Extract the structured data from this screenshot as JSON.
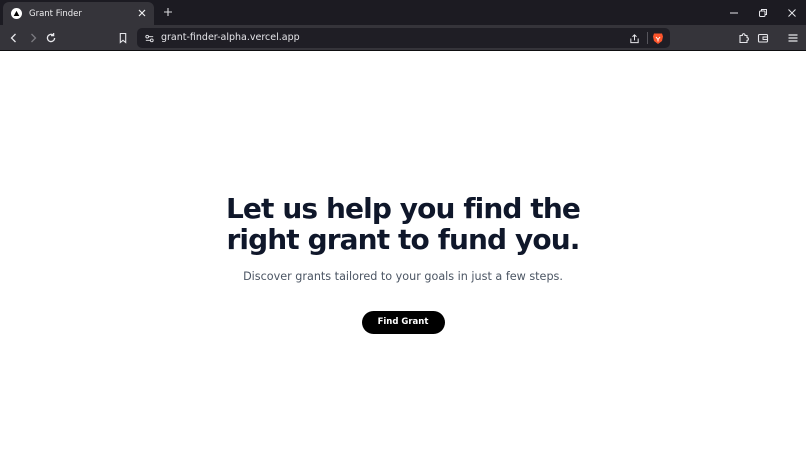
{
  "browser": {
    "tab": {
      "title": "Grant Finder"
    },
    "address_bar": {
      "url": "grant-finder-alpha.vercel.app"
    },
    "icons": {
      "tab_favicon": "vercel-triangle-icon",
      "tab_close": "close-icon",
      "new_tab": "plus-icon",
      "back": "arrow-left-icon",
      "forward": "arrow-right-icon",
      "reload": "reload-icon",
      "bookmark": "bookmark-icon",
      "site_info": "site-settings-icon",
      "share": "share-icon",
      "brave_shields": "brave-lion-icon",
      "extensions": "puzzle-icon",
      "wallet": "wallet-icon",
      "menu": "hamburger-menu-icon"
    },
    "colors": {
      "shields": "#fb542b",
      "chrome_dark": "#1c1b22",
      "toolbar": "#35343a"
    }
  },
  "hero": {
    "headline_line1": "Let us help you find the",
    "headline_line2": "right grant to fund you.",
    "subtitle": "Discover grants tailored to your goals in just a few steps.",
    "cta_label": "Find Grant",
    "colors": {
      "headline": "#0f172a",
      "subtitle": "#4b5563",
      "button_bg": "#000000",
      "button_text": "#ffffff"
    }
  }
}
